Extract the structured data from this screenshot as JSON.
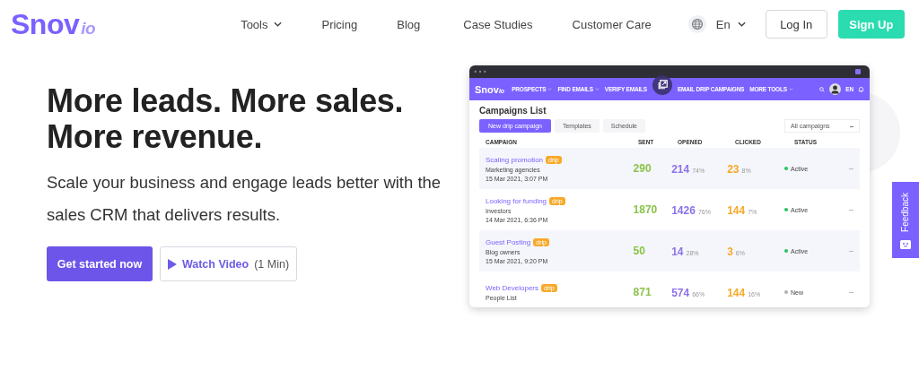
{
  "header": {
    "logo": {
      "main": "Snov",
      "suffix": "io"
    },
    "menu": [
      {
        "label": "Tools",
        "dropdown": true
      },
      {
        "label": "Pricing",
        "dropdown": false
      },
      {
        "label": "Blog",
        "dropdown": false
      },
      {
        "label": "Case Studies",
        "dropdown": false
      },
      {
        "label": "Customer Care",
        "dropdown": false
      }
    ],
    "language": "En",
    "login": "Log In",
    "signup": "Sign Up"
  },
  "hero": {
    "headline": [
      "More leads. More sales.",
      "More revenue."
    ],
    "subtitle": "Scale your business and engage leads better with the sales CRM that delivers results.",
    "primary_button": "Get started now",
    "video_button": {
      "label": "Watch Video",
      "duration": "(1 Min)"
    }
  },
  "mockup": {
    "logo": {
      "main": "Snov",
      "suffix": "io"
    },
    "nav": [
      {
        "label": "PROSPECTS",
        "dropdown": true
      },
      {
        "label": "FIND EMAILS",
        "dropdown": true
      },
      {
        "label": "VERIFY EMAILS",
        "dropdown": false
      },
      {
        "label": "EMAIL DRIP CAMPAIGNS",
        "dropdown": false
      },
      {
        "label": "MORE TOOLS",
        "dropdown": true
      }
    ],
    "language": "EN",
    "title": "Campaigns List",
    "new_button": "New drip campaign",
    "templates": "Templates",
    "schedule": "Schedule",
    "filter": "All campaigns",
    "columns": [
      "CAMPAIGN",
      "SENT",
      "OPENED",
      "CLICKED",
      "STATUS"
    ],
    "rows": [
      {
        "name": "Scaling promotion",
        "tag": "drip",
        "audience": "Marketing agencies",
        "date": "15 Mar 2021, 3:07 PM",
        "sent": "290",
        "opened": "214",
        "opened_pct": "74%",
        "clicked": "23",
        "clicked_pct": "8%",
        "status": {
          "label": "Active",
          "color": "#22c55e"
        }
      },
      {
        "name": "Looking for funding",
        "tag": "drip",
        "audience": "Investors",
        "date": "14 Mar 2021, 6:36 PM",
        "sent": "1870",
        "opened": "1426",
        "opened_pct": "76%",
        "clicked": "144",
        "clicked_pct": "7%",
        "status": {
          "label": "Active",
          "color": "#22c55e"
        }
      },
      {
        "name": "Guest Posting",
        "tag": "drip",
        "audience": "Blog owners",
        "date": "15 Mar 2021, 9:20 PM",
        "sent": "50",
        "opened": "14",
        "opened_pct": "28%",
        "clicked": "3",
        "clicked_pct": "6%",
        "status": {
          "label": "Active",
          "color": "#22c55e"
        }
      },
      {
        "name": "Web Developers",
        "tag": "drip",
        "audience": "People List",
        "sent": "871",
        "opened": "574",
        "opened_pct": "66%",
        "clicked": "144",
        "clicked_pct": "16%",
        "status": {
          "label": "New",
          "color": "#b0b0b8"
        }
      }
    ]
  },
  "feedback": "Feedback"
}
